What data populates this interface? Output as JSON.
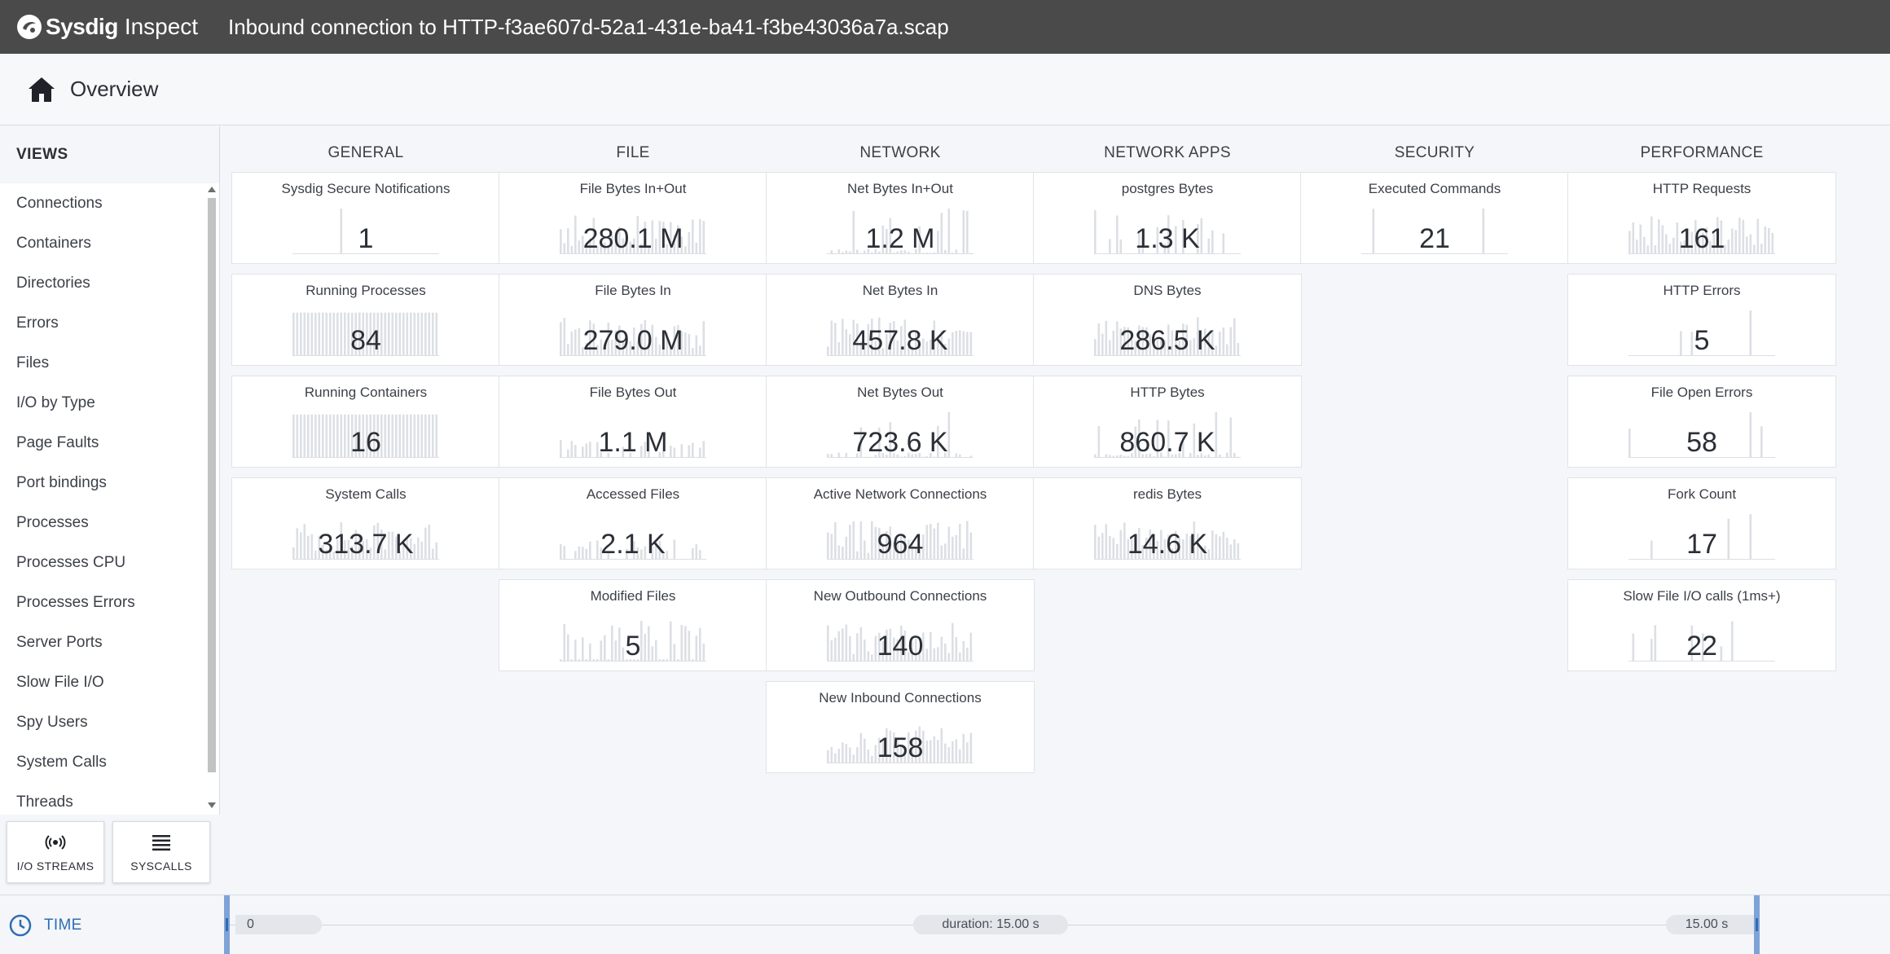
{
  "app": {
    "brand": "Sysdig",
    "product": "Inspect",
    "capture_title": "Inbound connection to HTTP-f3ae607d-52a1-431e-ba41-f3be43036a7a.scap"
  },
  "page": {
    "title": "Overview",
    "icon": "home-icon"
  },
  "sidebar": {
    "header": "VIEWS",
    "items": [
      "Connections",
      "Containers",
      "Directories",
      "Errors",
      "Files",
      "I/O by Type",
      "Page Faults",
      "Port bindings",
      "Processes",
      "Processes CPU",
      "Processes Errors",
      "Server Ports",
      "Slow File I/O",
      "Spy Users",
      "System Calls",
      "Threads"
    ],
    "buttons": [
      {
        "label": "I/O STREAMS",
        "icon": "broadcast-icon"
      },
      {
        "label": "SYSCALLS",
        "icon": "list-icon"
      }
    ]
  },
  "columns": [
    {
      "title": "GENERAL",
      "tiles": [
        {
          "title": "Sysdig Secure Notifications",
          "value": "1",
          "chart": "notif"
        },
        {
          "title": "Running Processes",
          "value": "84",
          "chart": "dense"
        },
        {
          "title": "Running Containers",
          "value": "16",
          "chart": "dense"
        },
        {
          "title": "System Calls",
          "value": "313.7 K",
          "chart": "busy"
        }
      ]
    },
    {
      "title": "FILE",
      "tiles": [
        {
          "title": "File Bytes In+Out",
          "value": "280.1 M",
          "chart": "busy"
        },
        {
          "title": "File Bytes In",
          "value": "279.0 M",
          "chart": "busy"
        },
        {
          "title": "File Bytes Out",
          "value": "1.1 M",
          "chart": "medium"
        },
        {
          "title": "Accessed Files",
          "value": "2.1 K",
          "chart": "medium"
        },
        {
          "title": "Modified Files",
          "value": "5",
          "chart": "bars"
        }
      ]
    },
    {
      "title": "NETWORK",
      "tiles": [
        {
          "title": "Net Bytes In+Out",
          "value": "1.2 M",
          "chart": "spiky"
        },
        {
          "title": "Net Bytes In",
          "value": "457.8 K",
          "chart": "busy"
        },
        {
          "title": "Net Bytes Out",
          "value": "723.6 K",
          "chart": "spiky"
        },
        {
          "title": "Active Network Connections",
          "value": "964",
          "chart": "busy"
        },
        {
          "title": "New Outbound Connections",
          "value": "140",
          "chart": "busy"
        },
        {
          "title": "New Inbound Connections",
          "value": "158",
          "chart": "busy"
        }
      ]
    },
    {
      "title": "NETWORK APPS",
      "tiles": [
        {
          "title": "postgres Bytes",
          "value": "1.3 K",
          "chart": "sparse"
        },
        {
          "title": "DNS Bytes",
          "value": "286.5 K",
          "chart": "busy"
        },
        {
          "title": "HTTP Bytes",
          "value": "860.7 K",
          "chart": "spiky"
        },
        {
          "title": "redis Bytes",
          "value": "14.6 K",
          "chart": "busy"
        }
      ]
    },
    {
      "title": "SECURITY",
      "tiles": [
        {
          "title": "Executed Commands",
          "value": "21",
          "chart": "few"
        }
      ]
    },
    {
      "title": "PERFORMANCE",
      "tiles": [
        {
          "title": "HTTP Requests",
          "value": "161",
          "chart": "busy"
        },
        {
          "title": "HTTP Errors",
          "value": "5",
          "chart": "few"
        },
        {
          "title": "File Open Errors",
          "value": "58",
          "chart": "few"
        },
        {
          "title": "Fork Count",
          "value": "17",
          "chart": "few"
        },
        {
          "title": "Slow File I/O calls (1ms+)",
          "value": "22",
          "chart": "sparse"
        }
      ]
    }
  ],
  "timebar": {
    "label": "TIME",
    "start": "0",
    "duration": "duration: 15.00 s",
    "end": "15.00 s"
  },
  "colors": {
    "topbar": "#4a4a4a",
    "accent": "#2f6db5",
    "spark": "#dcdfe4"
  }
}
